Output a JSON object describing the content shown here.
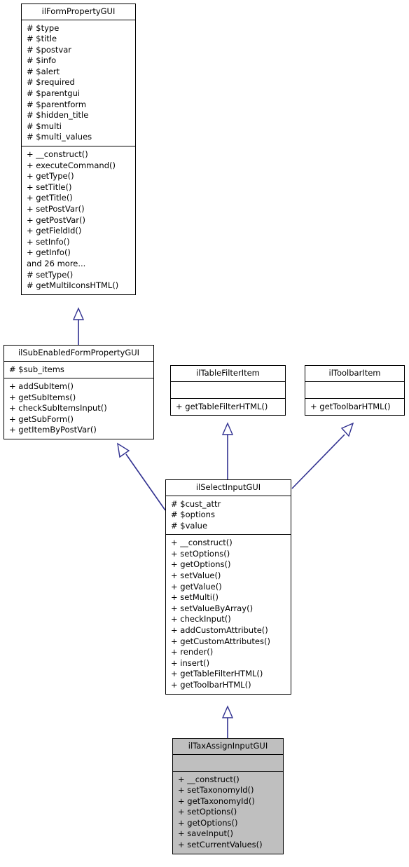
{
  "diagram": {
    "kind": "uml-class-inheritance-diagram",
    "colors": {
      "background": "#ffffff",
      "box_fill": "#ffffff",
      "highlight_fill": "#bfbfbf",
      "border": "#000000",
      "edge": "#303090"
    }
  },
  "classes": [
    {
      "id": "ilFormPropertyGUI",
      "name": "ilFormPropertyGUI",
      "highlighted": false,
      "attributes": [
        "# $type",
        "# $title",
        "# $postvar",
        "# $info",
        "# $alert",
        "# $required",
        "# $parentgui",
        "# $parentform",
        "# $hidden_title",
        "# $multi",
        "# $multi_values"
      ],
      "methods": [
        "+ __construct()",
        "+ executeCommand()",
        "+ getType()",
        "+ setTitle()",
        "+ getTitle()",
        "+ setPostVar()",
        "+ getPostVar()",
        "+ getFieldId()",
        "+ setInfo()",
        "+ getInfo()",
        "and 26 more...",
        "# setType()",
        "# getMultiIconsHTML()"
      ]
    },
    {
      "id": "ilSubEnabledFormPropertyGUI",
      "name": "ilSubEnabledFormPropertyGUI",
      "highlighted": false,
      "attributes": [
        "# $sub_items"
      ],
      "methods": [
        "+ addSubItem()",
        "+ getSubItems()",
        "+ checkSubItemsInput()",
        "+ getSubForm()",
        "+ getItemByPostVar()"
      ]
    },
    {
      "id": "ilTableFilterItem",
      "name": "ilTableFilterItem",
      "highlighted": false,
      "attributes": [],
      "methods": [
        "+ getTableFilterHTML()"
      ]
    },
    {
      "id": "ilToolbarItem",
      "name": "ilToolbarItem",
      "highlighted": false,
      "attributes": [],
      "methods": [
        "+ getToolbarHTML()"
      ]
    },
    {
      "id": "ilSelectInputGUI",
      "name": "ilSelectInputGUI",
      "highlighted": false,
      "attributes": [
        "# $cust_attr",
        "# $options",
        "# $value"
      ],
      "methods": [
        "+ __construct()",
        "+ setOptions()",
        "+ getOptions()",
        "+ setValue()",
        "+ getValue()",
        "+ setMulti()",
        "+ setValueByArray()",
        "+ checkInput()",
        "+ addCustomAttribute()",
        "+ getCustomAttributes()",
        "+ render()",
        "+ insert()",
        "+ getTableFilterHTML()",
        "+ getToolbarHTML()"
      ]
    },
    {
      "id": "ilTaxAssignInputGUI",
      "name": "ilTaxAssignInputGUI",
      "highlighted": true,
      "attributes": [],
      "methods": [
        "+ __construct()",
        "+ setTaxonomyId()",
        "+ getTaxonomyId()",
        "+ setOptions()",
        "+ getOptions()",
        "+ saveInput()",
        "+ setCurrentValues()"
      ]
    }
  ],
  "relationships": [
    {
      "from": "ilSubEnabledFormPropertyGUI",
      "to": "ilFormPropertyGUI",
      "type": "generalization"
    },
    {
      "from": "ilSelectInputGUI",
      "to": "ilSubEnabledFormPropertyGUI",
      "type": "generalization"
    },
    {
      "from": "ilSelectInputGUI",
      "to": "ilTableFilterItem",
      "type": "generalization"
    },
    {
      "from": "ilSelectInputGUI",
      "to": "ilToolbarItem",
      "type": "generalization"
    },
    {
      "from": "ilTaxAssignInputGUI",
      "to": "ilSelectInputGUI",
      "type": "generalization"
    }
  ]
}
